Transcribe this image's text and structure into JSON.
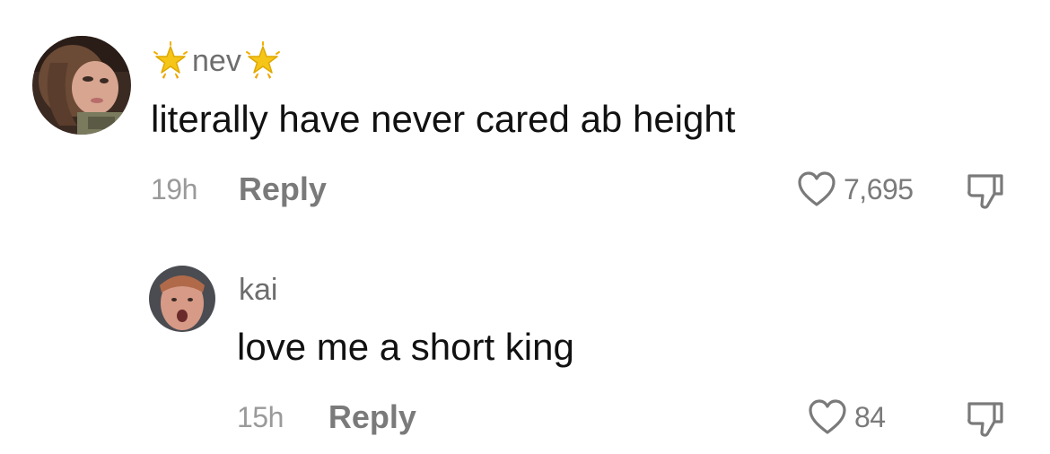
{
  "comments": [
    {
      "username": "nev",
      "username_decoration_icon": "glowing-star-icon",
      "text": "literally have never cared ab height",
      "time": "19h",
      "reply_label": "Reply",
      "likes": "7,695",
      "like_icon": "heart-outline-icon",
      "dislike_icon": "thumbs-down-icon"
    },
    {
      "username": "kai",
      "text": "love me a short king",
      "time": "15h",
      "reply_label": "Reply",
      "likes": "84",
      "like_icon": "heart-outline-icon",
      "dislike_icon": "thumbs-down-icon"
    }
  ],
  "colors": {
    "username": "#6e6e6e",
    "meta": "#9a9a9a",
    "reply": "#7a7a7a",
    "star": "#f5c518"
  }
}
